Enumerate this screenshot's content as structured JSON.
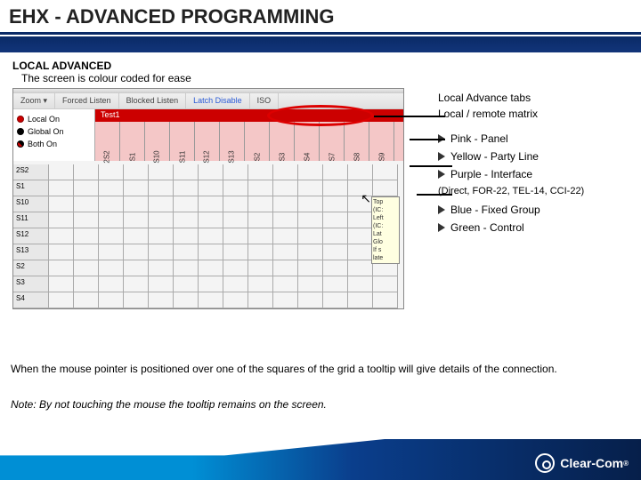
{
  "title": "EHX - ADVANCED PROGRAMMING",
  "sub": {
    "heading": "LOCAL ADVANCED",
    "desc": "The screen is colour coded for ease"
  },
  "app": {
    "win_title": "",
    "tabs": [
      "Zoom  ▾",
      "Forced Listen",
      "Blocked Listen",
      "Latch Disable",
      "ISO"
    ],
    "test_label": "Test1",
    "legend": {
      "local": "Local On",
      "global": "Global On",
      "both": "Both On"
    },
    "cols": [
      "2S2",
      "S1",
      "S10",
      "S11",
      "S12",
      "S13",
      "S2",
      "S3",
      "S4",
      "S7",
      "S8",
      "S9"
    ],
    "rows": [
      "2S2",
      "S1",
      "S10",
      "S11",
      "S12",
      "S13",
      "S2",
      "S3",
      "S4"
    ],
    "tooltip": [
      "Top",
      "(IC:",
      "Left",
      "(IC:",
      "Lat",
      "Glo",
      "If s",
      "late"
    ]
  },
  "annot": {
    "tabs": "Local Advance tabs",
    "matrix": "Local / remote matrix",
    "pink": "Pink - Panel",
    "yellow": "Yellow - Party Line",
    "purple": "Purple - Interface",
    "purple_sub": "(Direct, FOR-22, TEL-14, CCI-22)",
    "blue": "Blue - Fixed Group",
    "green": "Green - Control"
  },
  "bottom": {
    "line1": "When the mouse pointer is positioned over one of the squares of the grid a tooltip will give details of the connection.",
    "note": "Note: By not touching the mouse the tooltip remains on the screen."
  },
  "logo": {
    "text": "Clear-Com",
    "reg": "®"
  }
}
